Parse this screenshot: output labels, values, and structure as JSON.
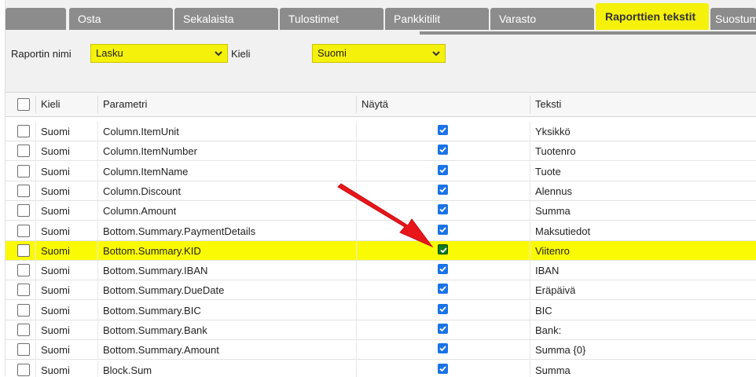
{
  "tabs": [
    {
      "label": ""
    },
    {
      "label": "Osta"
    },
    {
      "label": "Sekalaista"
    },
    {
      "label": "Tulostimet"
    },
    {
      "label": "Pankkitilit"
    },
    {
      "label": "Varasto"
    },
    {
      "label": "Raporttien tekstit"
    },
    {
      "label": "Suostum"
    }
  ],
  "filters": {
    "report_label": "Raportin nimi",
    "report_value": "Lasku",
    "language_label": "Kieli",
    "language_value": "Suomi"
  },
  "grid": {
    "columns": {
      "kieli": "Kieli",
      "parametri": "Parametri",
      "nayta": "Näytä",
      "teksti": "Teksti"
    },
    "rows": [
      {
        "kieli": "Suomi",
        "parametri": "Column.ItemUnit",
        "teksti": "Yksikkö",
        "checked": true
      },
      {
        "kieli": "Suomi",
        "parametri": "Column.ItemNumber",
        "teksti": "Tuotenro",
        "checked": true
      },
      {
        "kieli": "Suomi",
        "parametri": "Column.ItemName",
        "teksti": "Tuote",
        "checked": true
      },
      {
        "kieli": "Suomi",
        "parametri": "Column.Discount",
        "teksti": "Alennus",
        "checked": true
      },
      {
        "kieli": "Suomi",
        "parametri": "Column.Amount",
        "teksti": "Summa",
        "checked": true
      },
      {
        "kieli": "Suomi",
        "parametri": "Bottom.Summary.PaymentDetails",
        "teksti": "Maksutiedot",
        "checked": true
      },
      {
        "kieli": "Suomi",
        "parametri": "Bottom.Summary.KID",
        "teksti": "Viitenro",
        "checked": true,
        "highlighted": true
      },
      {
        "kieli": "Suomi",
        "parametri": "Bottom.Summary.IBAN",
        "teksti": "IBAN",
        "checked": true
      },
      {
        "kieli": "Suomi",
        "parametri": "Bottom.Summary.DueDate",
        "teksti": "Eräpäivä",
        "checked": true
      },
      {
        "kieli": "Suomi",
        "parametri": "Bottom.Summary.BIC",
        "teksti": "BIC",
        "checked": true
      },
      {
        "kieli": "Suomi",
        "parametri": "Bottom.Summary.Bank",
        "teksti": "Bank:",
        "checked": true
      },
      {
        "kieli": "Suomi",
        "parametri": "Bottom.Summary.Amount",
        "teksti": "Summa {0}",
        "checked": true
      },
      {
        "kieli": "Suomi",
        "parametri": "Block.Sum",
        "teksti": "Summa",
        "checked": true
      }
    ]
  },
  "colors": {
    "highlight": "#f5f10a",
    "tab_inactive": "#8c8c8c",
    "checkbox_blue": "#1a73e8",
    "checkbox_green": "#0e7a1e",
    "annotation_arrow": "#e8161b"
  },
  "icons": {
    "dropdown": "chevron-down-icon",
    "annotation": "red-arrow-icon"
  }
}
